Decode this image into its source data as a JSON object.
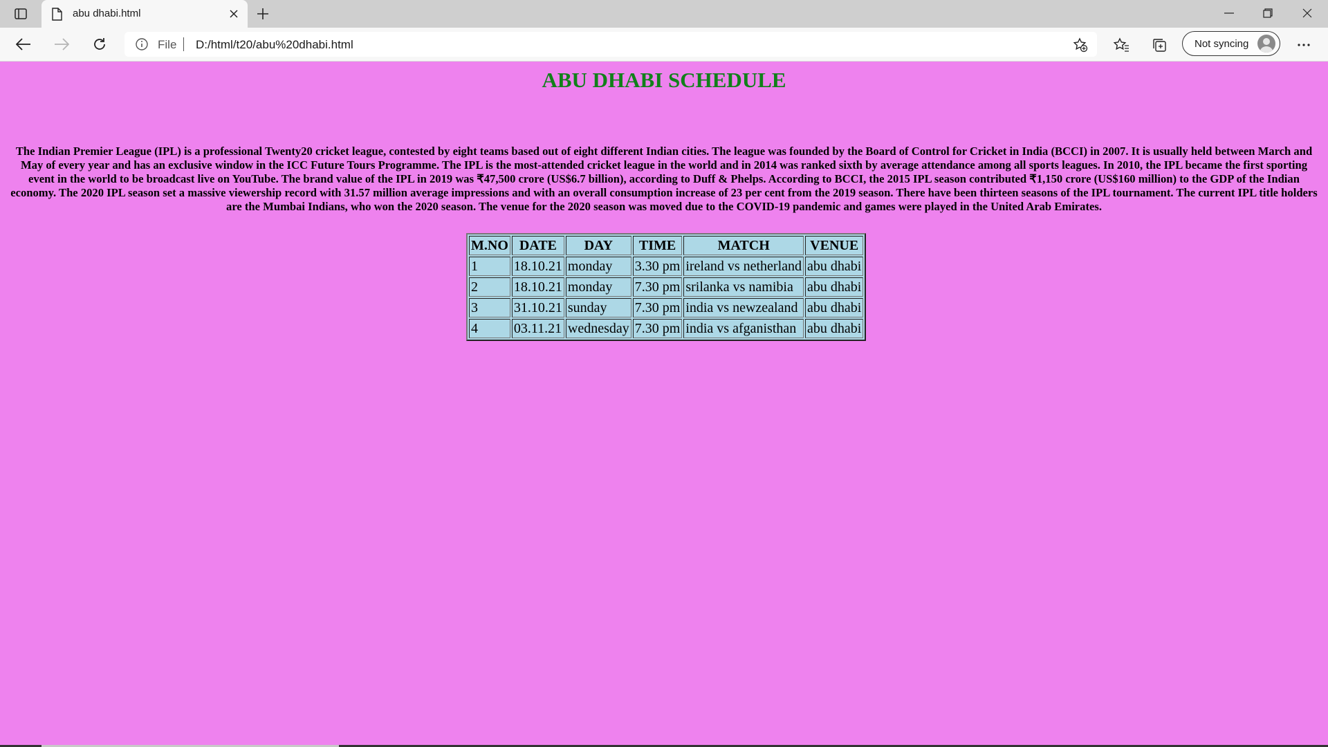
{
  "browser": {
    "tab_title": "abu dhabi.html",
    "address": {
      "scheme_label": "File",
      "url": "D:/html/t20/abu%20dhabi.html"
    },
    "profile_label": "Not syncing"
  },
  "page": {
    "title": "ABU DHABI SCHEDULE",
    "intro": "The Indian Premier League (IPL) is a professional Twenty20 cricket league, contested by eight teams based out of eight different Indian cities. The league was founded by the Board of Control for Cricket in India (BCCI) in 2007. It is usually held between March and May of every year and has an exclusive window in the ICC Future Tours Programme. The IPL is the most-attended cricket league in the world and in 2014 was ranked sixth by average attendance among all sports leagues. In 2010, the IPL became the first sporting event in the world to be broadcast live on YouTube. The brand value of the IPL in 2019 was ₹47,500 crore (US$6.7 billion), according to Duff & Phelps. According to BCCI, the 2015 IPL season contributed ₹1,150 crore (US$160 million) to the GDP of the Indian economy. The 2020 IPL season set a massive viewership record with 31.57 million average impressions and with an overall consumption increase of 23 per cent from the 2019 season. There have been thirteen seasons of the IPL tournament. The current IPL title holders are the Mumbai Indians, who won the 2020 season. The venue for the 2020 season was moved due to the COVID-19 pandemic and games were played in the United Arab Emirates.",
    "table": {
      "headers": [
        "M.NO",
        "DATE",
        "DAY",
        "TIME",
        "MATCH",
        "VENUE"
      ],
      "rows": [
        [
          "1",
          "18.10.21",
          "monday",
          "3.30 pm",
          "ireland vs netherland",
          "abu dhabi"
        ],
        [
          "2",
          "18.10.21",
          "monday",
          "7.30 pm",
          "srilanka vs namibia",
          "abu dhabi"
        ],
        [
          "3",
          "31.10.21",
          "sunday",
          "7.30 pm",
          "india vs newzealand",
          "abu dhabi"
        ],
        [
          "4",
          "03.11.21",
          "wednesday",
          "7.30 pm",
          "india vs afganisthan",
          "abu dhabi"
        ]
      ]
    }
  },
  "colors": {
    "page_background": "#ee82ee",
    "title_color": "#11801a",
    "table_background": "#add8e6"
  }
}
